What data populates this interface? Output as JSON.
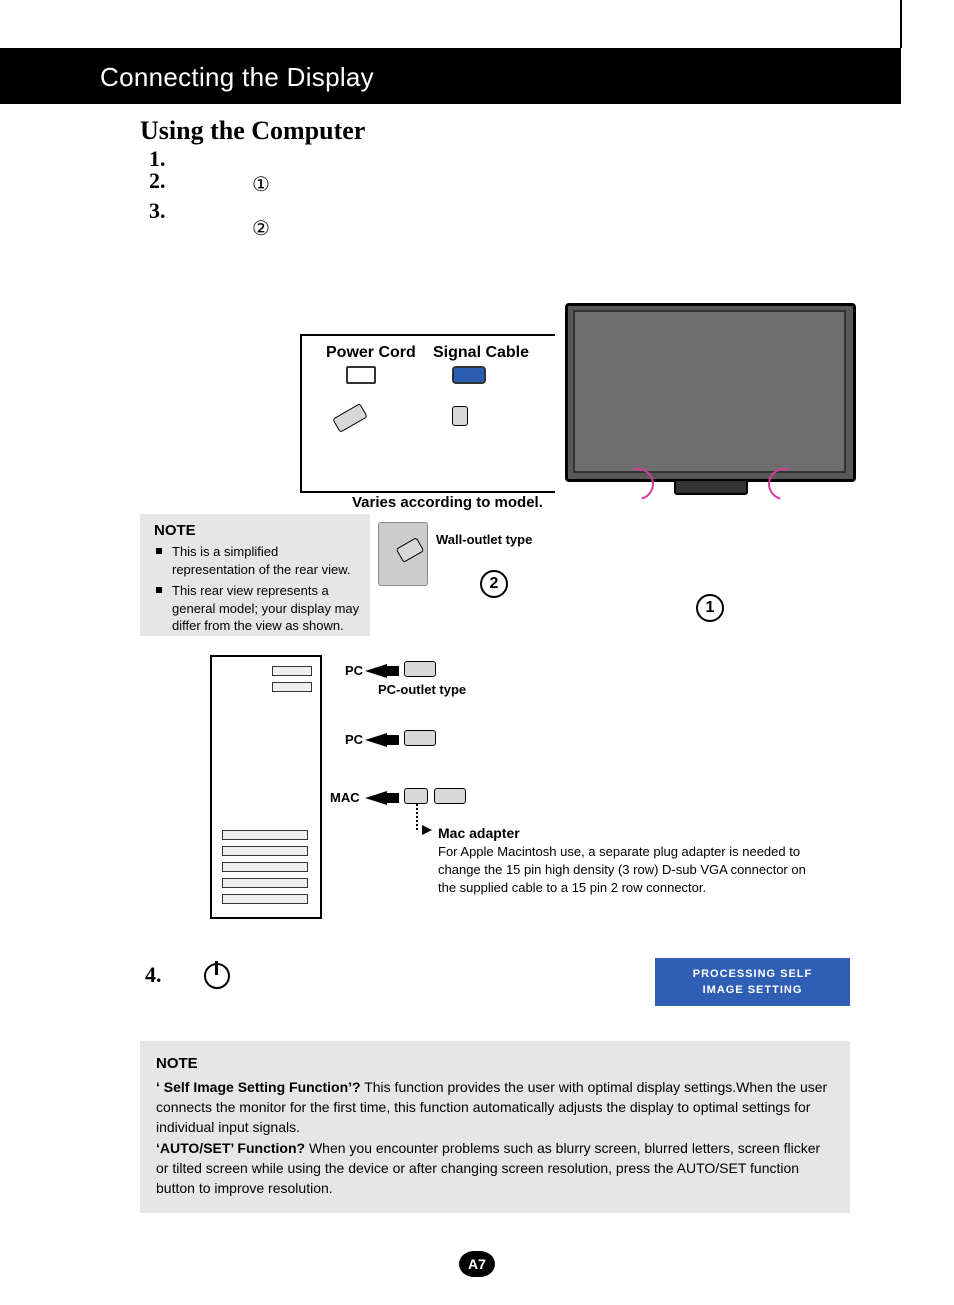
{
  "header": {
    "title": "Connecting the Display"
  },
  "section_title": "Using the Computer",
  "steps": {
    "one": "1.",
    "two": "2.",
    "three": "3.",
    "four": "4.",
    "circ1": "①",
    "circ2": "②"
  },
  "diagram": {
    "power_cord": "Power Cord",
    "signal_cable": "Signal Cable",
    "varies": "Varies according to model.",
    "wall_outlet": "Wall-outlet type",
    "pc_outlet": "PC-outlet type",
    "pc1": "PC",
    "pc2": "PC",
    "mac": "MAC",
    "mac_adapter": "Mac adapter",
    "mac_desc": "For Apple Macintosh use, a  separate plug adapter is needed to change the 15 pin high density (3 row) D-sub VGA connector on the supplied cable to a 15 pin  2 row connector.",
    "circ_d1": "1",
    "circ_d2": "2"
  },
  "note1": {
    "title": "NOTE",
    "items": [
      "This is a simplified representation of the rear view.",
      "This rear view represents a general model; your display may differ from the view as shown."
    ]
  },
  "blue_box": {
    "line1": "PROCESSING SELF",
    "line2": "IMAGE SETTING"
  },
  "note2": {
    "title": "NOTE",
    "self_label": "‘ Self Image Setting Function’?",
    "self_body": " This function provides the user with optimal display settings.When the user connects the monitor for the first time, this function automatically adjusts the display to optimal settings for individual input signals.",
    "auto_label": "‘AUTO/SET’ Function?",
    "auto_body": " When you encounter problems such as blurry screen, blurred letters, screen flicker or tilted screen while using the device or after changing screen resolution, press the AUTO/SET function button to improve resolution."
  },
  "page_number": "A7"
}
